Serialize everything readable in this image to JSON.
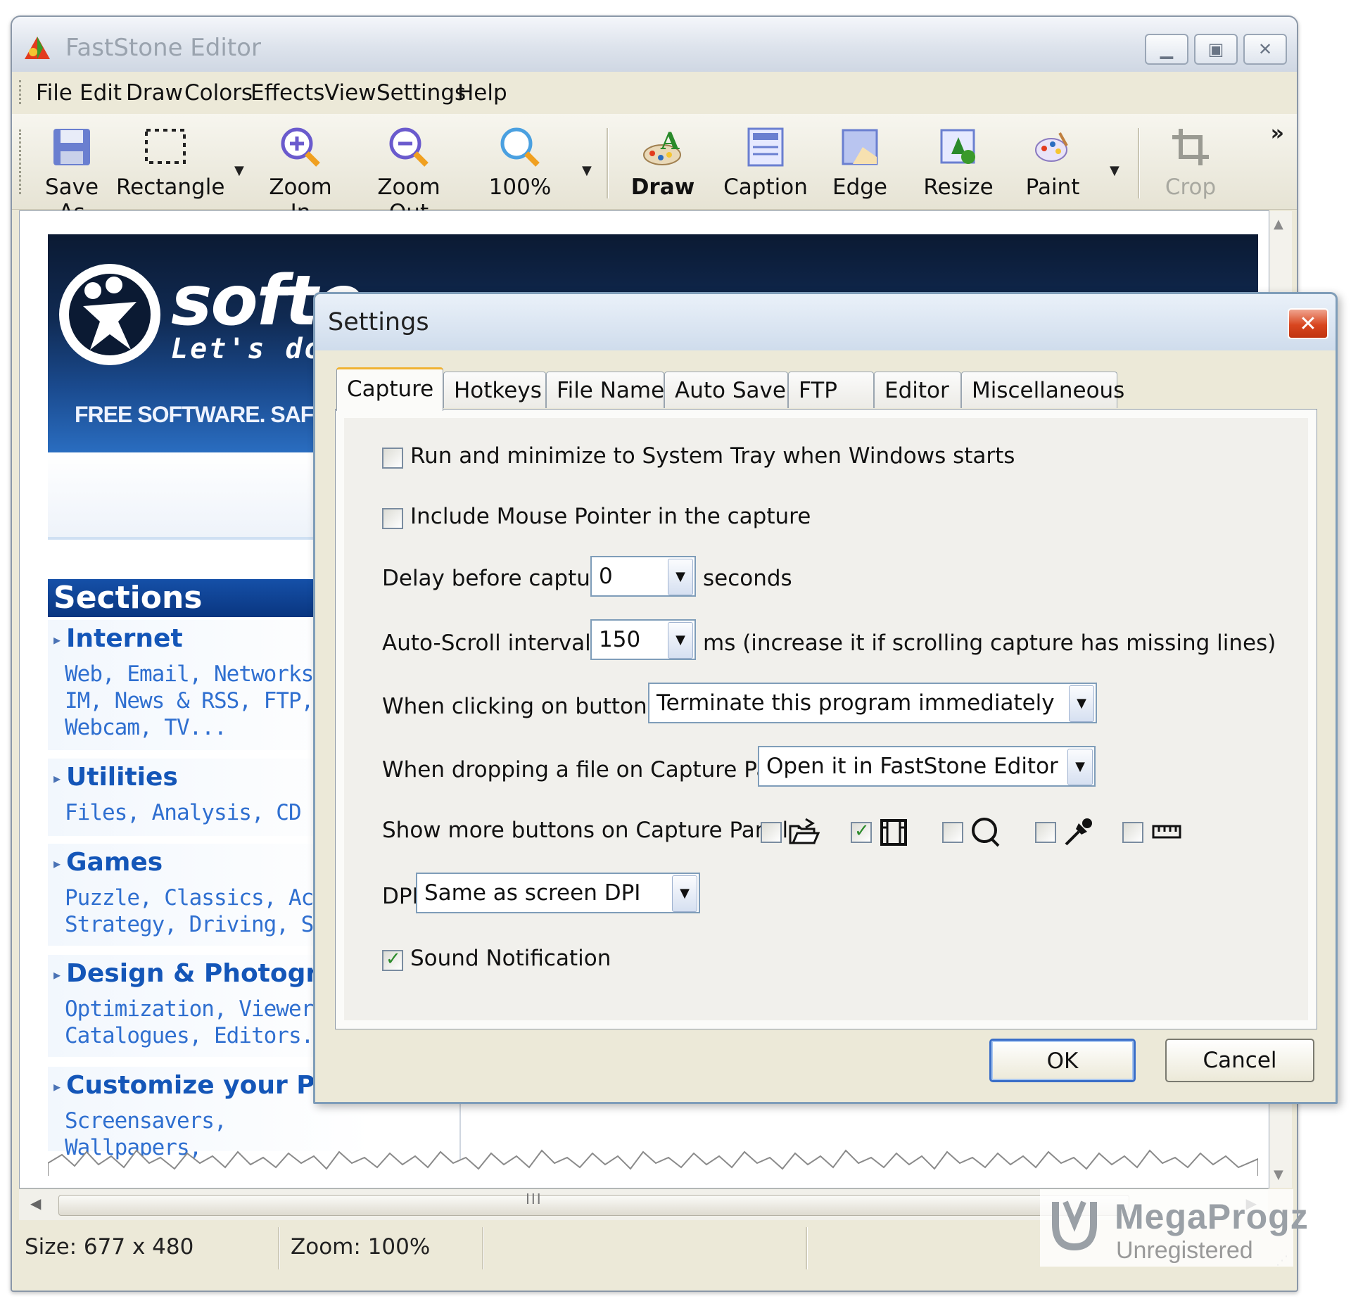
{
  "window": {
    "title": "FastStone Editor"
  },
  "menu": [
    "File",
    "Edit",
    "Draw",
    "Colors",
    "Effects",
    "View",
    "Settings",
    "Help"
  ],
  "toolbar": {
    "items": [
      {
        "label": "Save As",
        "icon": "save-icon"
      },
      {
        "label": "Rectangle",
        "icon": "rectangle-select-icon"
      },
      {
        "label": "Zoom In",
        "icon": "zoom-in-icon"
      },
      {
        "label": "Zoom Out",
        "icon": "zoom-out-icon"
      },
      {
        "label": "100%",
        "icon": "zoom-100-icon"
      },
      {
        "label": "Draw",
        "icon": "draw-icon"
      },
      {
        "label": "Caption",
        "icon": "caption-icon"
      },
      {
        "label": "Edge",
        "icon": "edge-icon"
      },
      {
        "label": "Resize",
        "icon": "resize-icon"
      },
      {
        "label": "Paint",
        "icon": "paint-icon"
      },
      {
        "label": "Crop",
        "icon": "crop-icon",
        "disabled": true
      }
    ]
  },
  "webpage": {
    "brand": "softo",
    "tagline": "Let's dow",
    "free_text": "FREE SOFTWARE. SAFE DO",
    "sections_header": "Sections",
    "sections": [
      {
        "title": "Internet",
        "desc": [
          "Web, Email, Networks",
          "IM, News & RSS, FTP,",
          "Webcam, TV..."
        ]
      },
      {
        "title": "Utilities",
        "desc": [
          "Files, Analysis, CD & D"
        ]
      },
      {
        "title": "Games",
        "desc": [
          "Puzzle, Classics, Actio",
          "Strategy, Driving, Spo"
        ]
      },
      {
        "title": "Design & Photogra",
        "desc": [
          "Optimization, Viewers",
          "Catalogues, Editors..."
        ]
      },
      {
        "title": "Customize your PC",
        "desc": [
          "Screensavers, Wallpapers,"
        ]
      }
    ]
  },
  "status": {
    "size": "Size: 677 x 480",
    "zoom": "Zoom: 100%"
  },
  "watermark": {
    "name": "MegaProgz",
    "sub": "Unregistered"
  },
  "dialog": {
    "title": "Settings",
    "tabs": [
      "Capture",
      "Hotkeys",
      "File Name",
      "Auto Save",
      "FTP",
      "Editor",
      "Miscellaneous"
    ],
    "active_tab": "Capture",
    "options": {
      "run_minimize": {
        "label": "Run and minimize to System Tray when Windows starts",
        "checked": false
      },
      "include_pointer": {
        "label": "Include Mouse Pointer in the capture",
        "checked": false
      },
      "delay": {
        "label": "Delay before capture :",
        "value": "0",
        "suffix": "seconds"
      },
      "autoscroll": {
        "label": "Auto-Scroll interval :",
        "value": "150",
        "suffix": "ms (increase it if scrolling capture has missing lines)"
      },
      "click_x": {
        "label": "When clicking on button [X] :",
        "value": "Terminate this program immediately"
      },
      "drop_file": {
        "label": "When dropping a file on Capture Panel :",
        "value": "Open it in FastStone Editor"
      },
      "more_buttons": {
        "label": "Show more buttons on Capture Panel :",
        "items": [
          {
            "icon": "open-folder-icon",
            "checked": false
          },
          {
            "icon": "film-icon",
            "checked": true
          },
          {
            "icon": "magnifier-icon",
            "checked": false
          },
          {
            "icon": "color-picker-icon",
            "checked": false
          },
          {
            "icon": "ruler-icon",
            "checked": false
          }
        ]
      },
      "dpi": {
        "label": "DPI :",
        "value": "Same as screen DPI"
      },
      "sound": {
        "label": "Sound Notification",
        "checked": true
      }
    },
    "ok_label": "OK",
    "cancel_label": "Cancel"
  }
}
